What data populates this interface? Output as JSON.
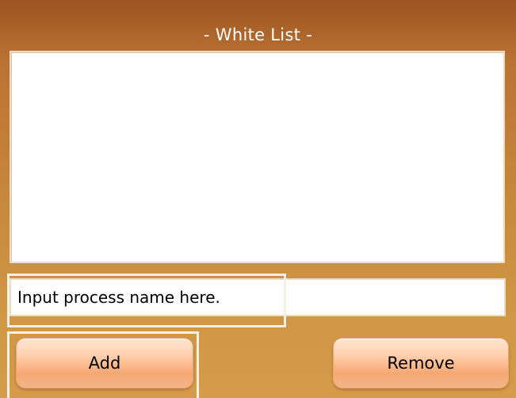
{
  "window": {
    "title": "- White List -"
  },
  "whitelist": {
    "items": []
  },
  "process_input": {
    "value": "Input process name here.",
    "placeholder": ""
  },
  "buttons": {
    "add_label": "Add",
    "remove_label": "Remove"
  },
  "colors": {
    "panel_top": "#b0652c",
    "panel_bottom": "#d49c4a",
    "button_light": "#ffe6d3",
    "button_dark": "#f7a872",
    "title_text": "#ffffff"
  }
}
